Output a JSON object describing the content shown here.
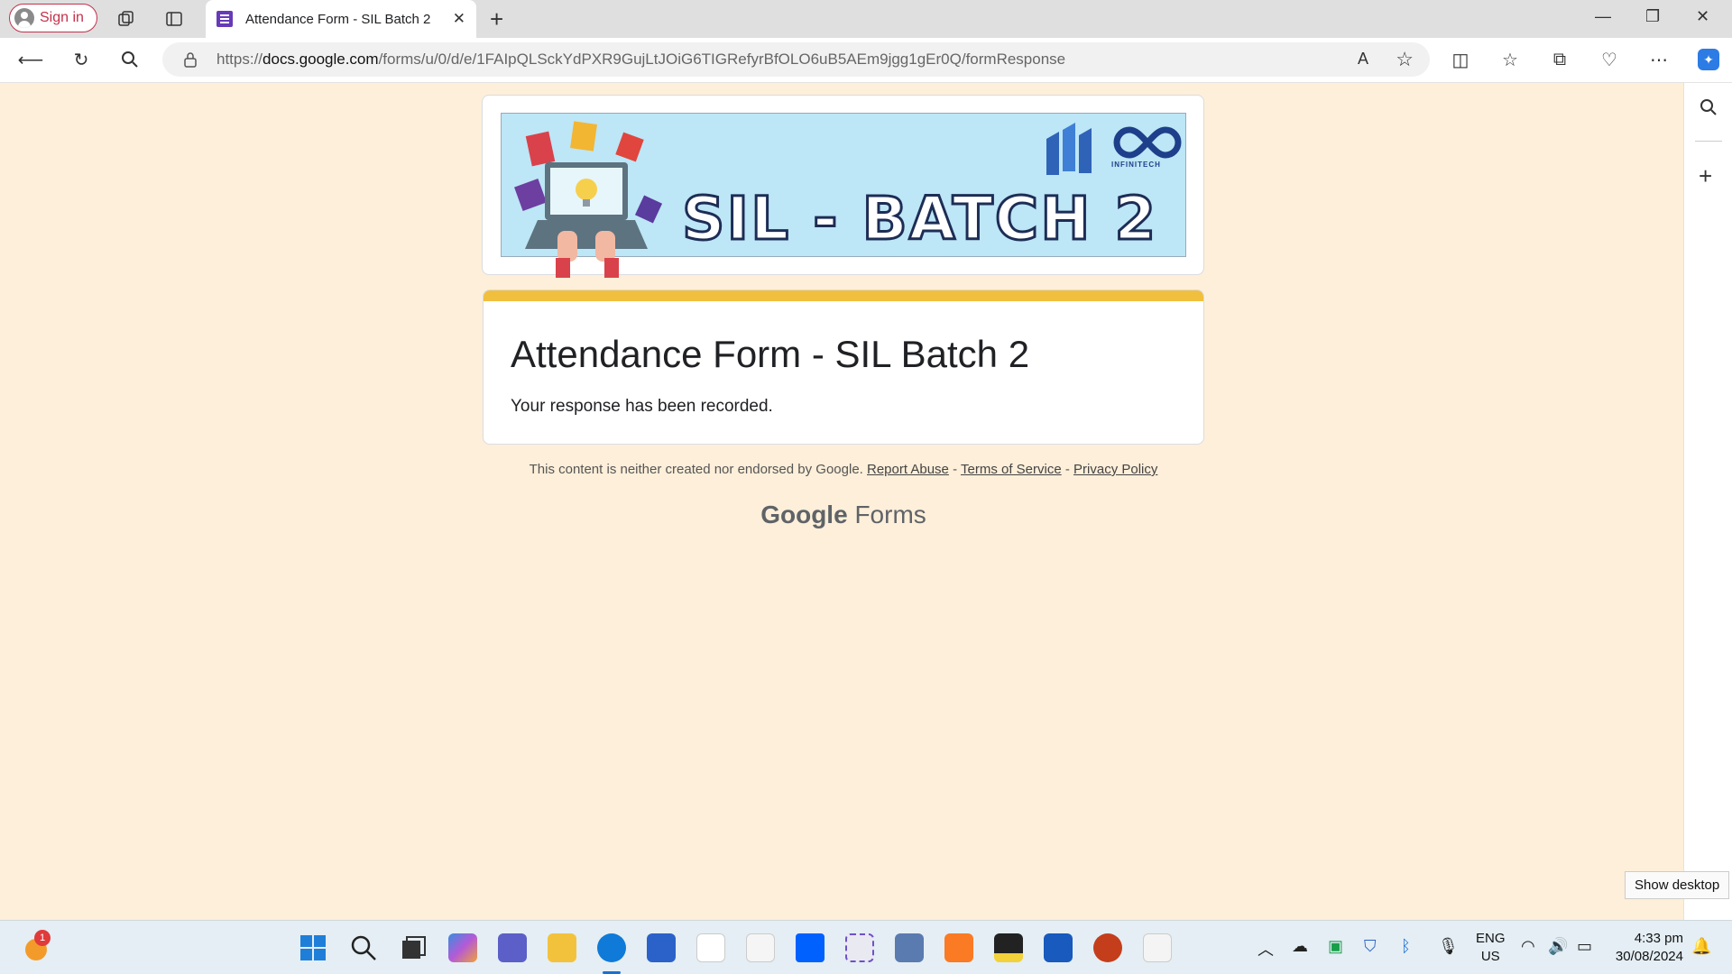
{
  "browser": {
    "signin_label": "Sign in",
    "tab_title": "Attendance Form - SIL Batch 2",
    "url_prefix": "https://",
    "url_domain": "docs.google.com",
    "url_path": "/forms/u/0/d/e/1FAIpQLSckYdPXR9GujLtJOiG6TIGRefyrBfOLO6uB5AEm9jgg1gEr0Q/formResponse"
  },
  "form": {
    "banner_text": "SIL - BATCH 2",
    "banner_logo_text": "INFINITECH",
    "title": "Attendance Form - SIL Batch 2",
    "response": "Your response has been recorded.",
    "disclaimer": "This content is neither created nor endorsed by Google.",
    "report_abuse": "Report Abuse",
    "separator": "-",
    "terms": "Terms of Service",
    "privacy": "Privacy Policy",
    "brand_google": "Google",
    "brand_forms": "Forms",
    "accent": "#f1bf3e",
    "background": "#fdefd9"
  },
  "taskbar": {
    "weather_badge": "1",
    "lang_line1": "ENG",
    "lang_line2": "US",
    "time": "4:33 pm",
    "date": "30/08/2024",
    "show_desktop": "Show desktop"
  }
}
